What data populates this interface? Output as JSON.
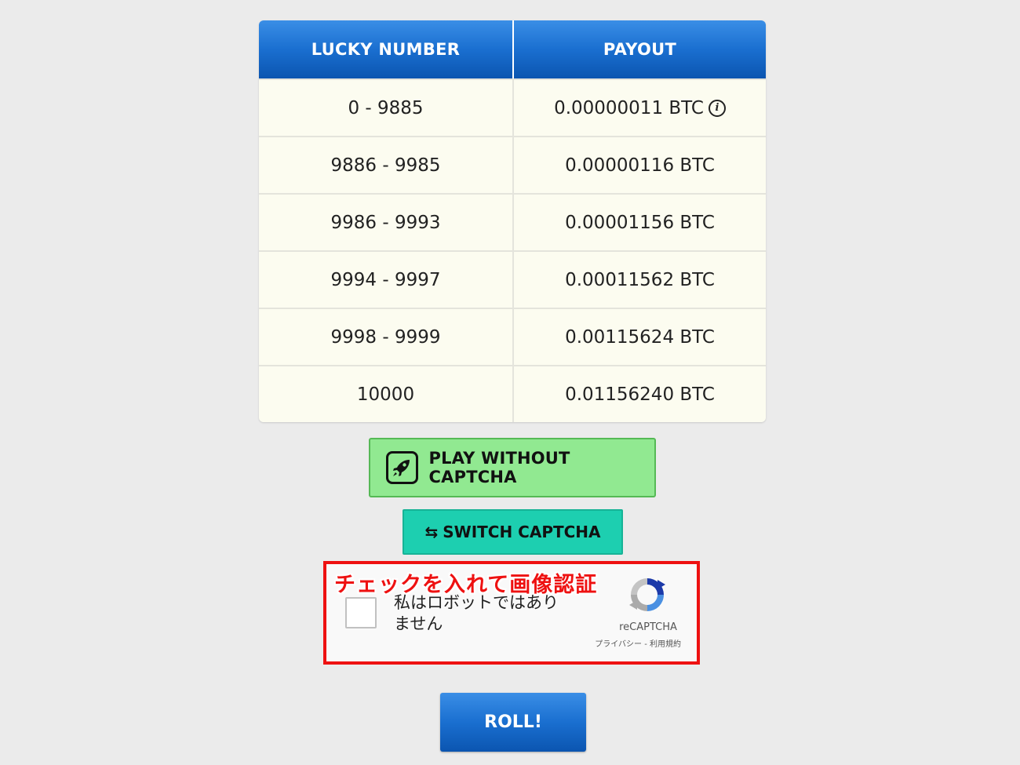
{
  "table": {
    "headers": [
      "LUCKY NUMBER",
      "PAYOUT"
    ],
    "rows": [
      {
        "range": "0 - 9885",
        "payout": "0.00000011 BTC"
      },
      {
        "range": "9886 - 9985",
        "payout": "0.00000116 BTC"
      },
      {
        "range": "9986 - 9993",
        "payout": "0.00001156 BTC"
      },
      {
        "range": "9994 - 9997",
        "payout": "0.00011562 BTC"
      },
      {
        "range": "9998 - 9999",
        "payout": "0.00115624 BTC"
      },
      {
        "range": "10000",
        "payout": "0.01156240 BTC"
      }
    ],
    "info_icon_glyph": "i"
  },
  "buttons": {
    "play_without_captcha": "PLAY WITHOUT CAPTCHA",
    "switch_captcha": "SWITCH CAPTCHA",
    "switch_icon": "⇆",
    "roll": "ROLL!"
  },
  "captcha": {
    "annotation": "チェックを入れて画像認証",
    "label": "私はロボットではありません",
    "brand": "reCAPTCHA",
    "links": "プライバシー - 利用規約"
  },
  "colors": {
    "header_blue": "#1a6fd0",
    "play_green": "#91e991",
    "switch_teal": "#1dcfb0",
    "annotation_red": "#ee1111"
  }
}
